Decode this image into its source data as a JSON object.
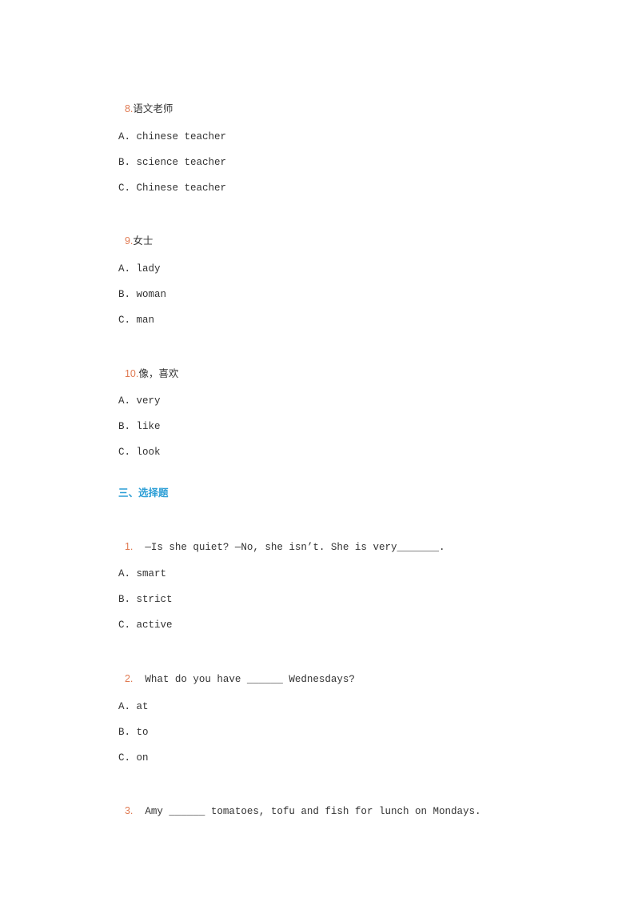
{
  "items": [
    {
      "number": "8.",
      "prompt": "语文老师",
      "options": [
        "A. chinese teacher",
        "B. science teacher",
        "C. Chinese teacher"
      ]
    },
    {
      "number": "9.",
      "prompt": "女士",
      "options": [
        "A. lady",
        "B. woman",
        "C. man"
      ]
    },
    {
      "number": "10.",
      "prompt": "像，喜欢",
      "options": [
        "A. very",
        "B. like",
        "C. look"
      ]
    }
  ],
  "section": {
    "title": "三、选择题"
  },
  "questions": [
    {
      "number": "1.",
      "text": "  —Is she quiet? —No, she isn’t. She is very_______.",
      "options": [
        "A. smart",
        "B. strict",
        "C. active"
      ]
    },
    {
      "number": "2.",
      "text": "  What do you have ______ Wednesdays?",
      "options": [
        "A. at",
        "B. to",
        "C. on"
      ]
    },
    {
      "number": "3.",
      "text": "  Amy ______ tomatoes, tofu and fish for lunch on Mondays."
    }
  ],
  "colors": {
    "number": "#e07a52",
    "section": "#2e9fd6",
    "text": "#333333"
  }
}
